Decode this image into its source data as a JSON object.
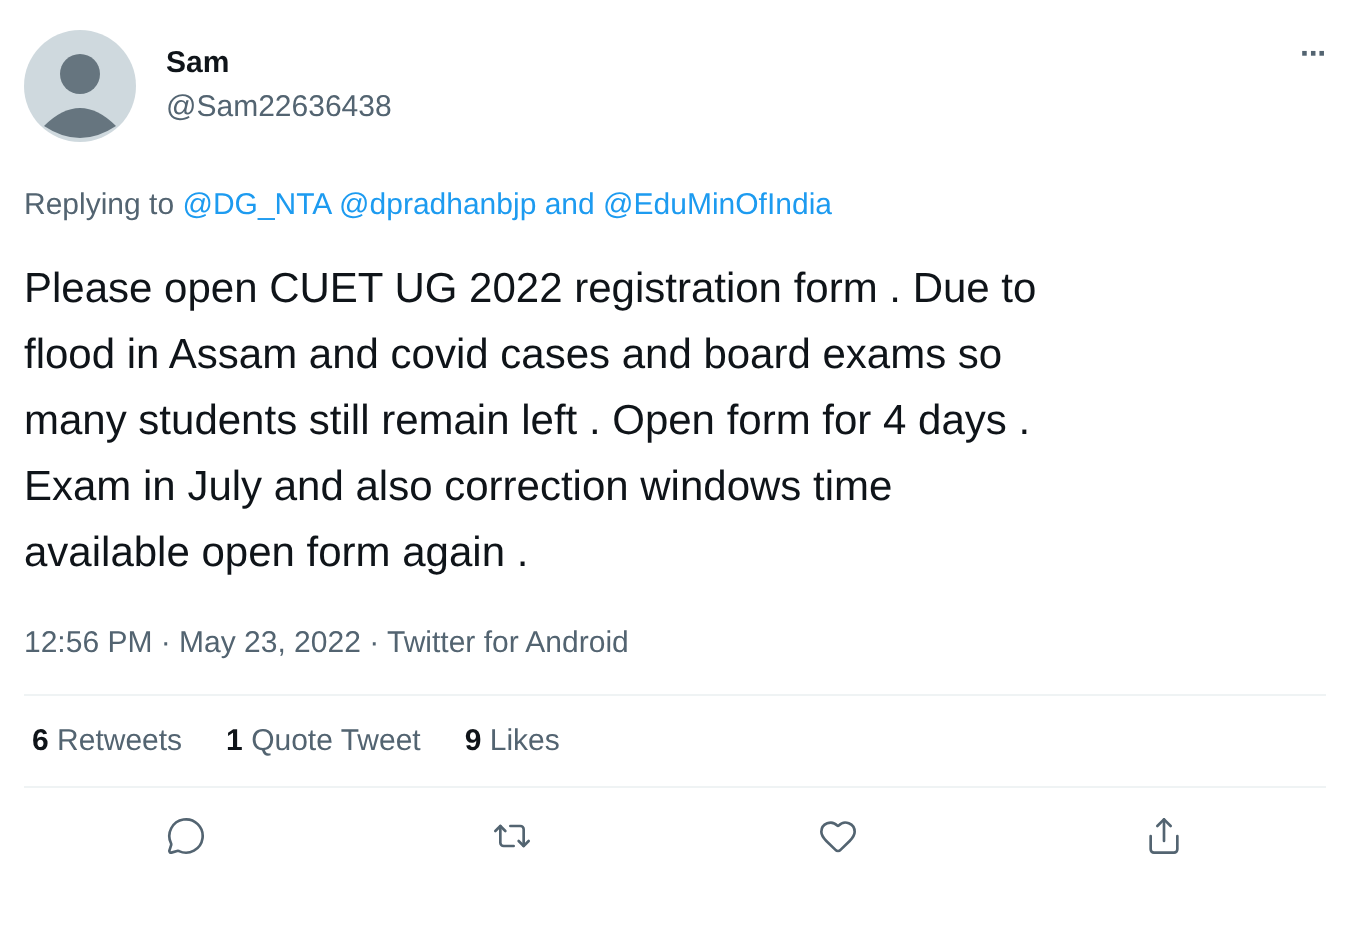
{
  "author": {
    "name": "Sam",
    "handle": "@Sam22636438"
  },
  "more_menu": "···",
  "replying": {
    "label": "Replying to",
    "mentions": [
      "@DG_NTA",
      "@dpradhanbjp"
    ],
    "conjunction": "and",
    "last": "@EduMinOfIndia"
  },
  "body": "Please open CUET UG 2022 registration form . Due to\nflood in Assam and covid cases and board exams so\nmany students still remain left . Open form for 4 days .\nExam in July and also correction windows time\navailable open form again .",
  "meta": "12:56 PM · May 23, 2022 · Twitter for Android",
  "stats": [
    {
      "count": "6",
      "label": "Retweets"
    },
    {
      "count": "1",
      "label": "Quote Tweet"
    },
    {
      "count": "9",
      "label": "Likes"
    }
  ],
  "actions": [
    {
      "kind": "reply"
    },
    {
      "kind": "retweet"
    },
    {
      "kind": "like"
    },
    {
      "kind": "share"
    }
  ]
}
